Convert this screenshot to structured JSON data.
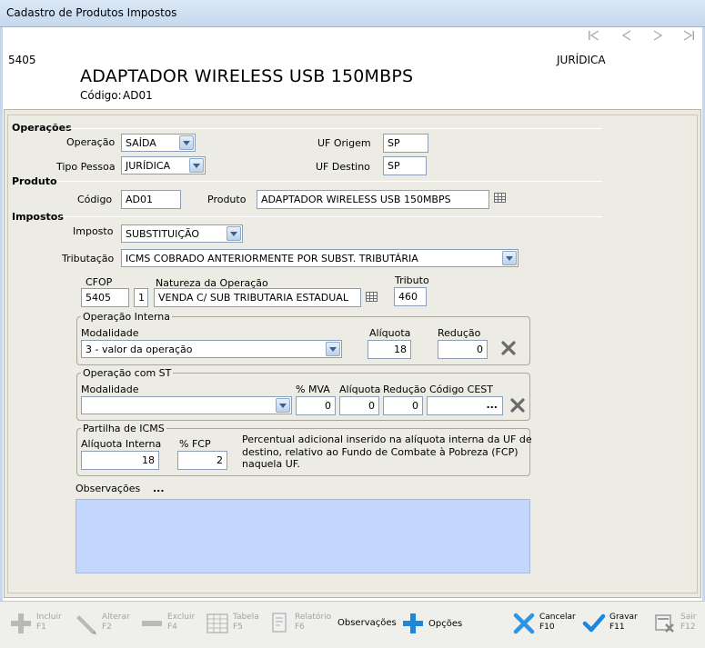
{
  "window": {
    "title": "Cadastro de Produtos Impostos"
  },
  "nav": {
    "first_icon": "first-record-icon",
    "prev_icon": "prev-record-icon",
    "next_icon": "next-record-icon",
    "last_icon": "last-record-icon"
  },
  "header": {
    "record_code": "5405",
    "person_type": "JURÍDICA",
    "product_name": "ADAPTADOR WIRELESS USB 150MBPS",
    "code_label": "Código:",
    "code_value": "AD01"
  },
  "operacoes": {
    "section_title": "Operações",
    "operacao_label": "Operação",
    "operacao_value": "SAÍDA",
    "tipo_pessoa_label": "Tipo Pessoa",
    "tipo_pessoa_value": "JURÍDICA",
    "uf_origem_label": "UF Origem",
    "uf_origem_value": "SP",
    "uf_destino_label": "UF Destino",
    "uf_destino_value": "SP"
  },
  "produto": {
    "section_title": "Produto",
    "codigo_label": "Código",
    "codigo_value": "AD01",
    "produto_label": "Produto",
    "produto_value": "ADAPTADOR WIRELESS USB 150MBPS"
  },
  "impostos": {
    "section_title": "Impostos",
    "imposto_label": "Imposto",
    "imposto_value": "SUBSTITUIÇÃO",
    "tributacao_label": "Tributação",
    "tributacao_value": "ICMS COBRADO ANTERIORMENTE POR SUBST. TRIBUTÁRIA",
    "cfop_label": "CFOP",
    "cfop_value": "5405",
    "cfop_seq": "1",
    "natureza_label": "Natureza da Operação",
    "natureza_value": "VENDA C/ SUB TRIBUTARIA ESTADUAL",
    "tributo_label": "Tributo",
    "tributo_value": "460"
  },
  "operacao_interna": {
    "title": "Operação Interna",
    "modalidade_label": "Modalidade",
    "modalidade_value": "3 - valor da operação",
    "aliquota_label": "Alíquota",
    "aliquota_value": "18",
    "reducao_label": "Redução",
    "reducao_value": "0"
  },
  "operacao_st": {
    "title": "Operação com ST",
    "modalidade_label": "Modalidade",
    "modalidade_value": "",
    "mva_label": "% MVA",
    "mva_value": "0",
    "aliquota_label": "Alíquota",
    "aliquota_value": "0",
    "reducao_label": "Redução",
    "reducao_value": "0",
    "cest_label": "Código CEST",
    "cest_value": "",
    "cest_btn": "..."
  },
  "partilha": {
    "title": "Partilha de ICMS",
    "aliquota_interna_label": "Alíquota Interna",
    "aliquota_interna_value": "18",
    "fcp_label": "% FCP",
    "fcp_value": "2",
    "note_line1": "Percentual adicional inserido na alíquota interna da UF de",
    "note_line2": "destino, relativo ao Fundo de Combate à Pobreza (FCP)",
    "note_line3": "naquela UF."
  },
  "observacoes": {
    "label": "Observações",
    "more": "...",
    "value": ""
  },
  "toolbar": {
    "incluir": "Incluir",
    "incluir_key": "F1",
    "alterar": "Alterar",
    "alterar_key": "F2",
    "excluir": "Excluir",
    "excluir_key": "F4",
    "tabela": "Tabela",
    "tabela_key": "F5",
    "relatorio": "Relatório",
    "relatorio_key": "F6",
    "observacoes": "Observações",
    "opcoes": "Opções",
    "cancelar": "Cancelar",
    "cancelar_key": "F10",
    "gravar": "Gravar",
    "gravar_key": "F11",
    "sair": "Sair",
    "sair_key": "F12"
  },
  "colors": {
    "accent_blue": "#1f86d8",
    "obs_bg": "#c3d7fc",
    "delete_x": "#6b6b6b"
  }
}
